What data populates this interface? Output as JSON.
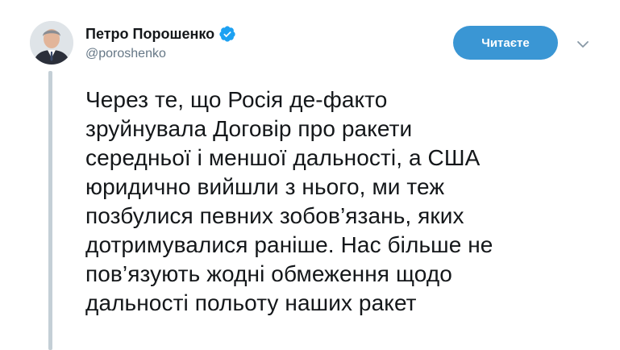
{
  "author": {
    "display_name": "Петро Порошенко",
    "handle": "@poroshenko",
    "verified": true,
    "avatar_icon": "profile-photo",
    "verified_icon": "verified-badge-icon"
  },
  "actions": {
    "follow_label": "Читаєте",
    "more_icon": "chevron-down-icon"
  },
  "tweet": {
    "lines": [
      "Через те, що Росія де-факто",
      "зруйнувала Договір про ракети",
      "середньої і меншої дальності, а США",
      "юридично вийшли з нього, ми теж",
      "позбулися певних зобов’язань, яких",
      "дотримувалися раніше. Нас більше не",
      "пов’язують жодні обмеження щодо",
      "дальності польоту наших ракет"
    ]
  },
  "colors": {
    "accent": "#3a96d4",
    "verified": "#1da1f2",
    "text": "#14171a",
    "secondary_text": "#657786",
    "thread_line": "#c4cfd6"
  }
}
